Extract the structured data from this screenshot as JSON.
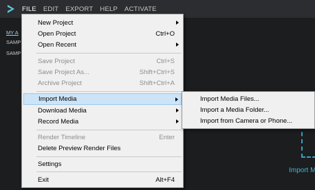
{
  "menubar": {
    "items": [
      {
        "label": "FILE"
      },
      {
        "label": "EDIT"
      },
      {
        "label": "EXPORT"
      },
      {
        "label": "HELP"
      },
      {
        "label": "ACTIVATE"
      }
    ]
  },
  "media_panel": {
    "link": "MY A",
    "items": [
      "SAMP",
      "SAMP"
    ],
    "import_hint": "Import M"
  },
  "file_menu": {
    "new_project": "New Project",
    "open_project": "Open Project",
    "open_project_accel": "Ctrl+O",
    "open_recent": "Open Recent",
    "save_project": "Save Project",
    "save_project_accel": "Ctrl+S",
    "save_project_as": "Save Project As...",
    "save_project_as_accel": "Shift+Ctrl+S",
    "archive_project": "Archive Project",
    "archive_project_accel": "Shift+Ctrl+A",
    "import_media": "Import Media",
    "download_media": "Download Media",
    "record_media": "Record Media",
    "render_timeline": "Render Timeline",
    "render_timeline_accel": "Enter",
    "delete_preview": "Delete Preview Render Files",
    "settings": "Settings",
    "exit": "Exit",
    "exit_accel": "Alt+F4"
  },
  "import_submenu": {
    "files": "Import Media Files...",
    "folder": "Import a Media Folder...",
    "camera": "Import from Camera or Phone..."
  },
  "colors": {
    "highlight": "#cce4f7",
    "accent": "#4ab0d8"
  }
}
